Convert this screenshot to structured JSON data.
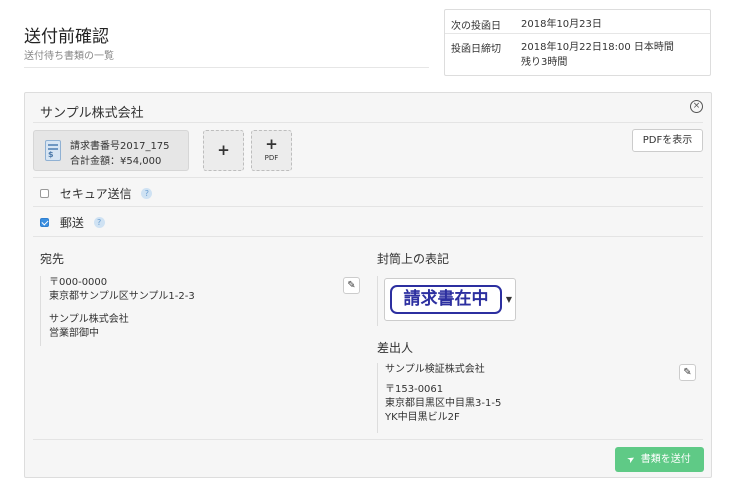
{
  "header": {
    "title": "送付前確認",
    "subtitle": "送付待ち書類の一覧"
  },
  "info": {
    "next_posting_label": "次の投函日",
    "next_posting_value": "2018年10月23日",
    "deadline_label": "投函日締切",
    "deadline_value": "2018年10月22日18:00 日本時間",
    "remaining": "残り3時間"
  },
  "panel": {
    "company": "サンプル株式会社",
    "document": {
      "name": "請求書番号2017_175",
      "total": "合計金額：¥54,000"
    },
    "add_plus": "+",
    "add_pdf_plus": "+",
    "add_pdf_label": "PDF",
    "pdf_view_label": "PDFを表示",
    "options": {
      "secure": {
        "label": "セキュア送信",
        "checked": false
      },
      "mail": {
        "label": "郵送",
        "checked": true
      }
    },
    "help_glyph": "?",
    "recipient": {
      "heading": "宛先",
      "postal": "〒000-0000",
      "address": "東京都サンプル区サンプル1-2-3",
      "company": "サンプル株式会社",
      "dept": "営業部御中"
    },
    "envelope": {
      "heading": "封筒上の表記",
      "stamp_text": "請求書在中"
    },
    "sender": {
      "heading": "差出人",
      "company": "サンプル検証株式会社",
      "postal": "〒153-0061",
      "address": "東京都目黒区中目黒3-1-5",
      "building": "YK中目黒ビル2F"
    },
    "send_label": "書類を送付"
  },
  "colors": {
    "send_button": "#5fca86",
    "stamp": "#2c2fa0",
    "checkbox_checked": "#3b8fe0"
  }
}
